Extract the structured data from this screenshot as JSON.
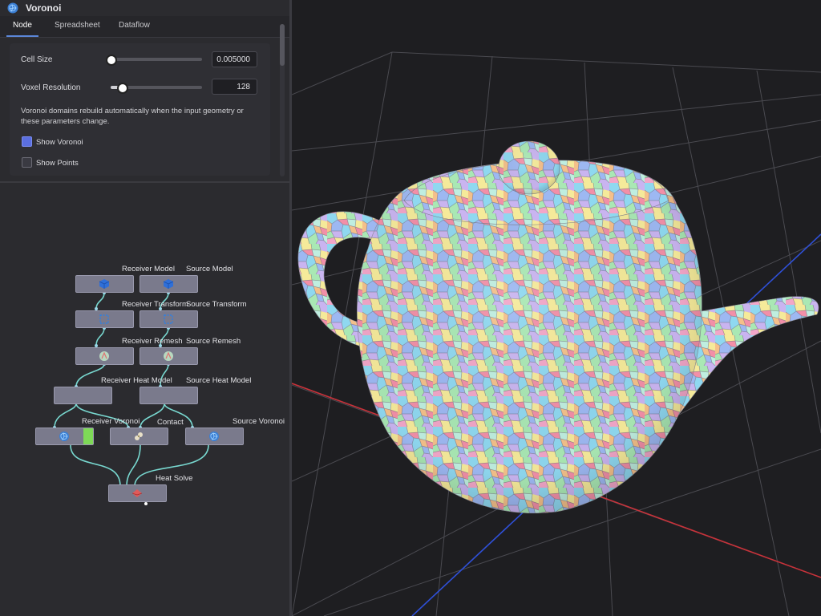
{
  "window": {
    "title": "Voronoi",
    "icon": "voronoi-sphere-icon"
  },
  "tabs": [
    {
      "label": "Node",
      "active": true
    },
    {
      "label": "Spreadsheet",
      "active": false
    },
    {
      "label": "Dataflow",
      "active": false
    }
  ],
  "params": {
    "cell_size": {
      "label": "Cell Size",
      "value": "0.005000",
      "slider_fraction": 0.0
    },
    "voxel_resolution": {
      "label": "Voxel Resolution",
      "value": "128",
      "slider_fraction": 0.1
    },
    "description": "Voronoi domains rebuild automatically when the input geometry or these parameters change.",
    "show_voronoi": {
      "label": "Show Voronoi",
      "checked": true
    },
    "show_points": {
      "label": "Show Points",
      "checked": false
    }
  },
  "graph": {
    "nodes": [
      {
        "id": "receiver-model",
        "label": "Receiver Model",
        "icon": "cube-icon"
      },
      {
        "id": "source-model",
        "label": "Source Model",
        "icon": "cube-icon"
      },
      {
        "id": "receiver-transform",
        "label": "Receiver Transform",
        "icon": "transform-icon"
      },
      {
        "id": "source-transform",
        "label": "Source Transform",
        "icon": "transform-icon"
      },
      {
        "id": "receiver-remesh",
        "label": "Receiver Remesh",
        "icon": "remesh-icon"
      },
      {
        "id": "source-remesh",
        "label": "Source Remesh",
        "icon": "remesh-icon"
      },
      {
        "id": "receiver-heat-model",
        "label": "Receiver Heat Model",
        "icon": ""
      },
      {
        "id": "source-heat-model",
        "label": "Source Heat Model",
        "icon": ""
      },
      {
        "id": "receiver-voronoi",
        "label": "Receiver Voronoi",
        "icon": "voronoi-sphere-icon"
      },
      {
        "id": "contact",
        "label": "Contact",
        "icon": "contact-icon"
      },
      {
        "id": "source-voronoi",
        "label": "Source Voronoi",
        "icon": "voronoi-sphere-icon"
      },
      {
        "id": "heat-solve",
        "label": "Heat Solve",
        "icon": "heat-solve-icon"
      }
    ]
  },
  "colors": {
    "accent": "#5b86d8",
    "wire": "#78d8d0",
    "selected": "#7ed957"
  },
  "viewport": {
    "model": "voronoi-colored-teapot"
  }
}
